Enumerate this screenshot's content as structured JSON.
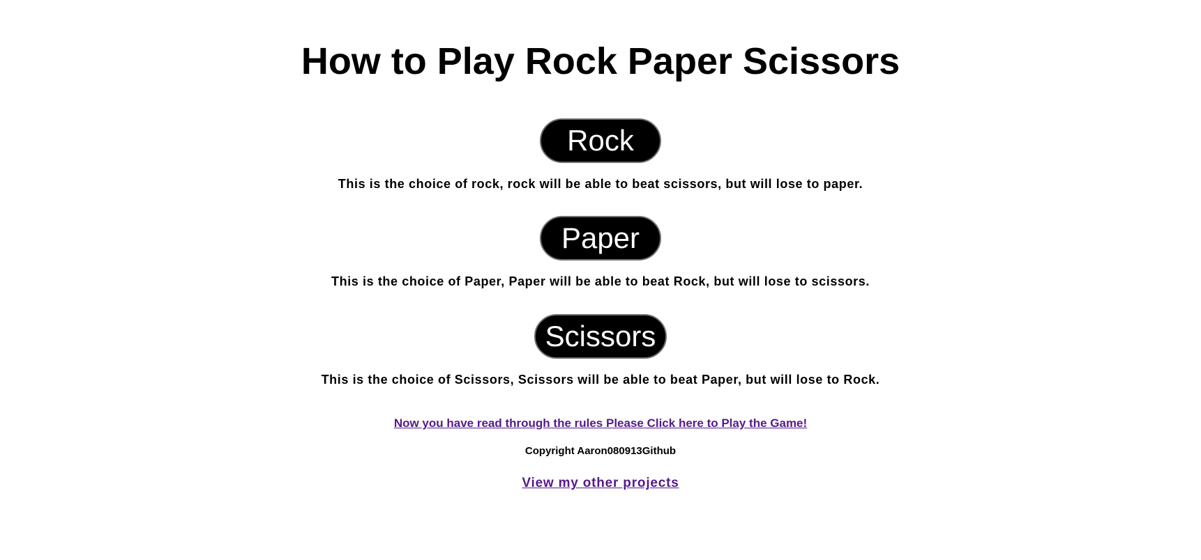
{
  "header": {
    "title": "How to Play Rock Paper Scissors"
  },
  "choices": [
    {
      "label": "Rock",
      "description": "This is the choice of rock, rock will be able to beat scissors, but will lose to paper."
    },
    {
      "label": "Paper",
      "description": "This is the choice of Paper, Paper will be able to beat Rock, but will lose to scissors."
    },
    {
      "label": "Scissors",
      "description": "This is the choice of Scissors, Scissors will be able to beat Paper, but will lose to Rock."
    }
  ],
  "footer": {
    "play_link": "Now you have read through the rules Please Click here to Play the Game!",
    "copyright": "Copyright Aaron080913Github",
    "projects_link": "View my other projects"
  },
  "colors": {
    "button_bg": "#000000",
    "button_text": "#ffffff",
    "button_border": "#6e6e6e",
    "link_visited": "#551a8b"
  }
}
